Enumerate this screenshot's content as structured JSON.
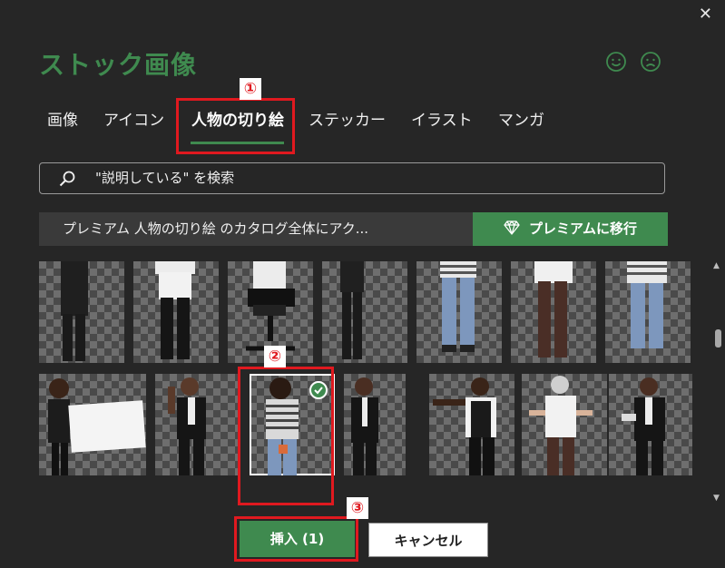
{
  "dialog": {
    "title": "ストック画像",
    "close_label": "✕"
  },
  "tabs": [
    {
      "label": "画像"
    },
    {
      "label": "アイコン"
    },
    {
      "label": "人物の切り絵",
      "active": true
    },
    {
      "label": "ステッカー"
    },
    {
      "label": "イラスト"
    },
    {
      "label": "マンガ"
    }
  ],
  "search": {
    "text": "\"説明している\" を検索"
  },
  "premium": {
    "message": "プレミアム 人物の切り絵 のカタログ全体にアク...",
    "button_label": "プレミアムに移行"
  },
  "gallery": {
    "selected_count": 1
  },
  "annotations": {
    "one": "①",
    "two": "②",
    "three": "③"
  },
  "footer": {
    "insert_label": "挿入 (1)",
    "cancel_label": "キャンセル"
  },
  "colors": {
    "accent": "#3f8a4f",
    "background": "#262626",
    "annotation_red": "#e0191f"
  }
}
